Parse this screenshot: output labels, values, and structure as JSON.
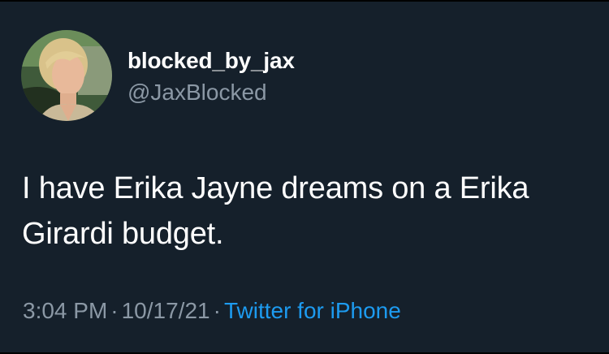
{
  "user": {
    "display_name": "blocked_by_jax",
    "handle": "@JaxBlocked",
    "avatar_icon": "profile-photo"
  },
  "tweet": {
    "text_line1": "I have Erika Jayne dreams on a Erika",
    "text_line2": "Girardi budget.",
    "time": "3:04 PM",
    "separator": "·",
    "date": "10/17/21",
    "source": "Twitter for iPhone"
  },
  "colors": {
    "background": "#15202b",
    "text_primary": "#ffffff",
    "text_secondary": "#8b98a5",
    "link": "#1d9bf0"
  }
}
